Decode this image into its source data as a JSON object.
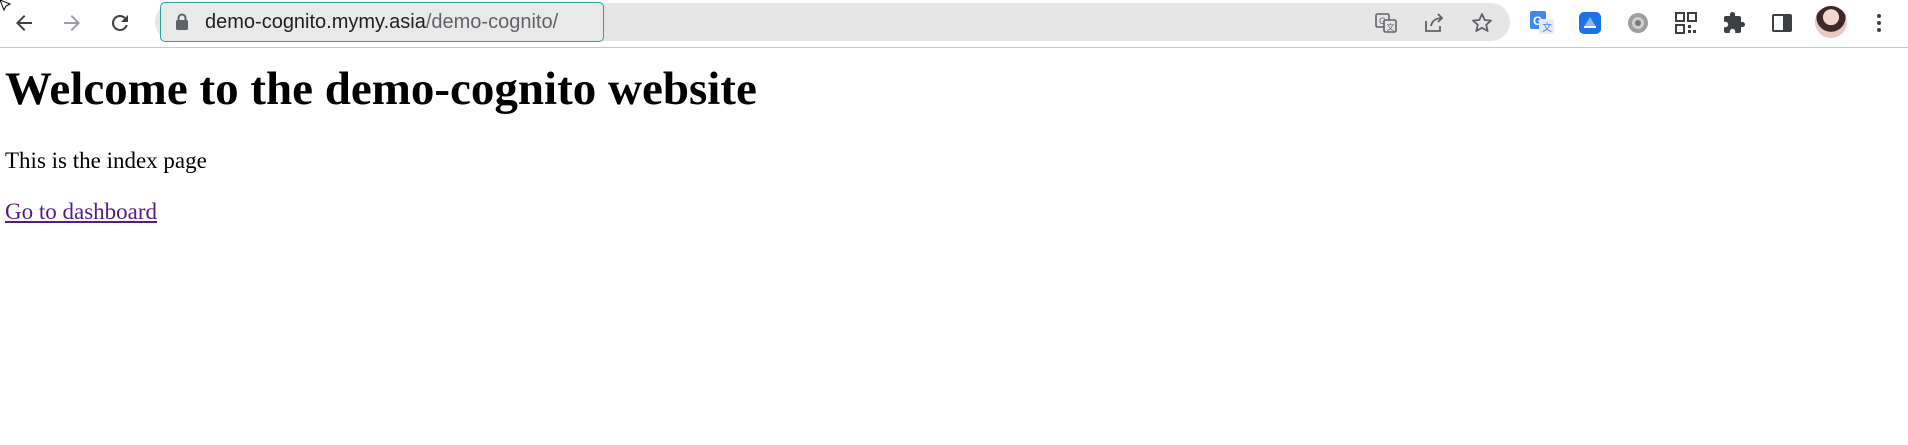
{
  "browser": {
    "url_host": "demo-cognito.mymy.asia",
    "url_path": "/demo-cognito/",
    "icons": {
      "back": "back-arrow-icon",
      "forward": "forward-arrow-icon",
      "reload": "reload-icon",
      "lock": "lock-icon",
      "translate": "translate-icon",
      "share": "share-icon",
      "bookmark": "star-icon",
      "extensions": [
        "google-translate-extension-icon",
        "blue-extension-icon",
        "gear-extension-icon",
        "qr-code-icon",
        "puzzle-extensions-icon",
        "side-panel-icon"
      ],
      "profile": "avatar",
      "menu": "kebab-menu-icon"
    },
    "accent_color": "#26a69a"
  },
  "page": {
    "heading": "Welcome to the demo-cognito website",
    "paragraph": "This is the index page",
    "link_label": "Go to dashboard",
    "link_color": "#551a8b"
  }
}
